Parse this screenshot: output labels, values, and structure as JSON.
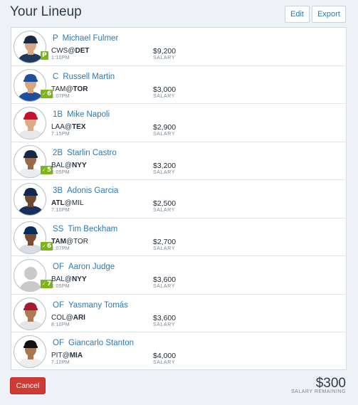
{
  "header": {
    "title": "Your Lineup",
    "edit_label": "Edit",
    "export_label": "Export"
  },
  "players": [
    {
      "pos": "P",
      "name": "Michael Fulmer",
      "team_a": "CWS",
      "team_b": "DET",
      "bold": "b",
      "time": "1:10PM",
      "salary": "$9,200",
      "salary_label": "SALARY",
      "badge": "P",
      "badge_check": false,
      "jersey": "#1f3a5a",
      "cap": "#1a2a44",
      "skin": "#d9a883",
      "placeholder": false
    },
    {
      "pos": "C",
      "name": "Russell Martin",
      "team_a": "TAM",
      "team_b": "TOR",
      "bold": "b",
      "time": "1:07PM",
      "salary": "$3,000",
      "salary_label": "SALARY",
      "badge": "6",
      "badge_check": true,
      "jersey": "#1d4f9c",
      "cap": "#1d4f9c",
      "skin": "#d8a67e",
      "placeholder": false
    },
    {
      "pos": "1B",
      "name": "Mike Napoli",
      "team_a": "LAA",
      "team_b": "TEX",
      "bold": "b",
      "time": "7:15PM",
      "salary": "$2,900",
      "salary_label": "SALARY",
      "badge": "",
      "badge_check": false,
      "jersey": "#e8e8ea",
      "cap": "#c8102e",
      "skin": "#dcaa85",
      "placeholder": false
    },
    {
      "pos": "2B",
      "name": "Starlin Castro",
      "team_a": "BAL",
      "team_b": "NYY",
      "bold": "b",
      "time": "1:05PM",
      "salary": "$3,200",
      "salary_label": "SALARY",
      "badge": "5",
      "badge_check": true,
      "jersey": "#e9ecf1",
      "cap": "#13294b",
      "skin": "#9a6a48",
      "placeholder": false
    },
    {
      "pos": "3B",
      "name": "Adonis Garcia",
      "team_a": "ATL",
      "team_b": "MIL",
      "bold": "a",
      "time": "7:10PM",
      "salary": "$2,500",
      "salary_label": "SALARY",
      "badge": "",
      "badge_check": false,
      "jersey": "#1b2f5c",
      "cap": "#13274f",
      "skin": "#6f4a30",
      "placeholder": false
    },
    {
      "pos": "SS",
      "name": "Tim Beckham",
      "team_a": "TAM",
      "team_b": "TOR",
      "bold": "a",
      "time": "1:07PM",
      "salary": "$2,700",
      "salary_label": "SALARY",
      "badge": "6",
      "badge_check": true,
      "jersey": "#d8dde4",
      "cap": "#092c5c",
      "skin": "#7a4d30",
      "placeholder": false
    },
    {
      "pos": "OF",
      "name": "Aaron Judge",
      "team_a": "BAL",
      "team_b": "NYY",
      "bold": "b",
      "time": "1:05PM",
      "salary": "$3,600",
      "salary_label": "SALARY",
      "badge": "7",
      "badge_check": true,
      "jersey": "#d9d9d9",
      "cap": "#d9d9d9",
      "skin": "#d9d9d9",
      "placeholder": true
    },
    {
      "pos": "OF",
      "name": "Yasmany Tomás",
      "team_a": "COL",
      "team_b": "ARI",
      "bold": "b",
      "time": "8:10PM",
      "salary": "$3,600",
      "salary_label": "SALARY",
      "badge": "",
      "badge_check": false,
      "jersey": "#e6e6e6",
      "cap": "#a71930",
      "skin": "#b07a55",
      "placeholder": false
    },
    {
      "pos": "OF",
      "name": "Giancarlo Stanton",
      "team_a": "PIT",
      "team_b": "MIA",
      "bold": "b",
      "time": "7:10PM",
      "salary": "$4,000",
      "salary_label": "SALARY",
      "badge": "",
      "badge_check": false,
      "jersey": "#eeeeee",
      "cap": "#111111",
      "skin": "#a9764f",
      "placeholder": false
    }
  ],
  "footer": {
    "cancel_label": "Cancel",
    "remaining_amount": "$300",
    "remaining_label": "SALARY REMAINING"
  }
}
